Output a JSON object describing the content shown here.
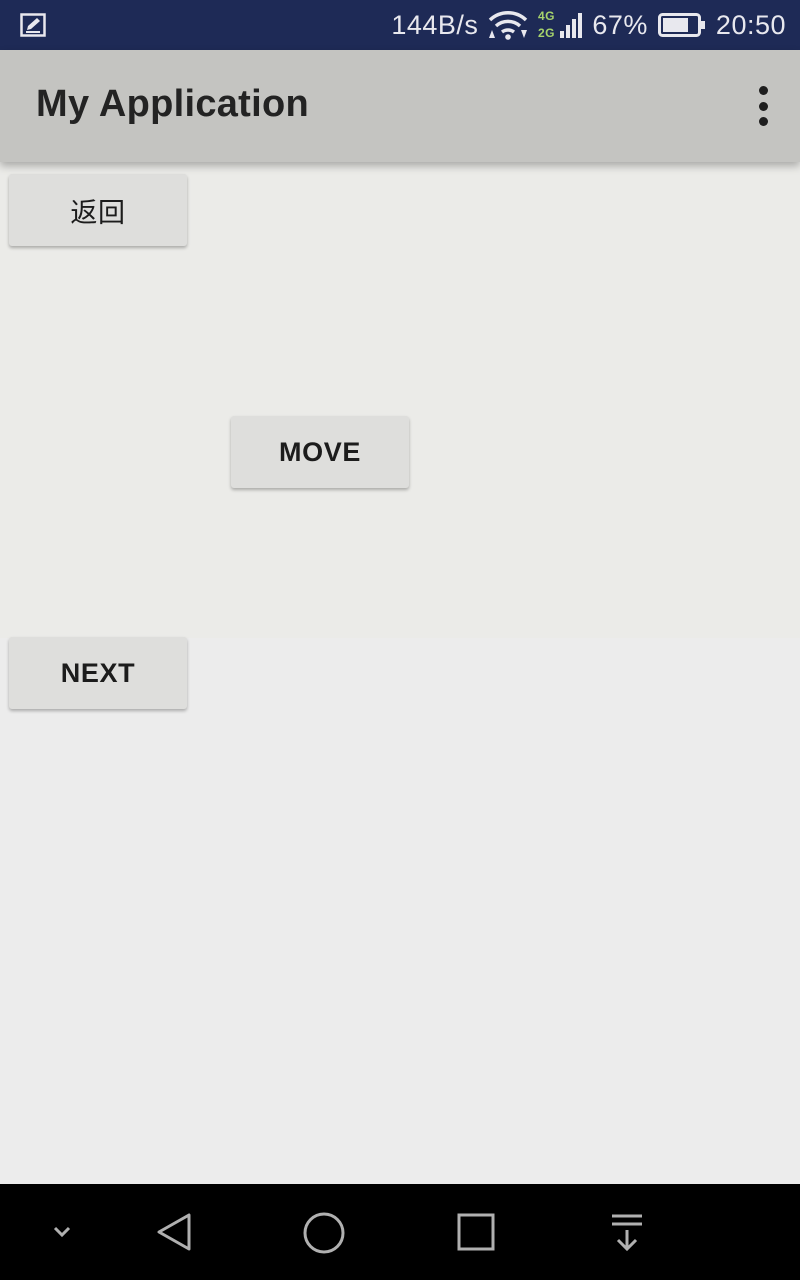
{
  "status_bar": {
    "icons": [
      "edit-note-icon",
      "wifi-icon",
      "cell-signal-icon",
      "battery-icon"
    ],
    "network_speed": "144B/s",
    "signal_labels": [
      "4G",
      "2G"
    ],
    "battery": "67%",
    "time": "20:50"
  },
  "app_bar": {
    "title": "My Application",
    "menu_icon": "overflow-menu-icon"
  },
  "buttons": {
    "back": "返回",
    "move": "MOVE",
    "next": "NEXT"
  },
  "nav_bar": {
    "icons": [
      "hide-nav-icon",
      "back-icon",
      "home-icon",
      "recents-icon",
      "notification-pull-icon"
    ]
  },
  "colors": {
    "status_bar": "#1e2a56",
    "app_bar": "#c4c4c1",
    "background": "#ececec",
    "button": "#dededc",
    "nav_bar": "#000000"
  }
}
